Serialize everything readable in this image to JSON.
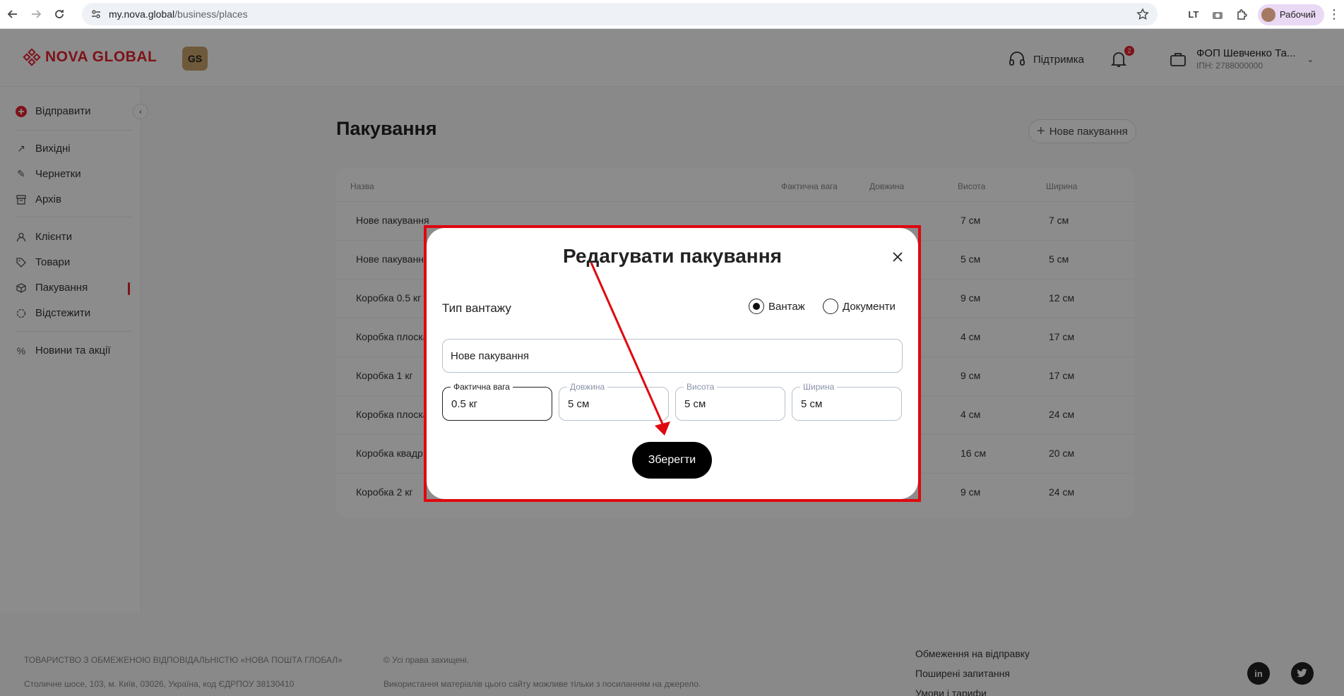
{
  "browser": {
    "url_host": "my.nova.global",
    "url_path": "/business/places",
    "ext_label": "LT",
    "profile_label": "Рабочий"
  },
  "header": {
    "logo_text": "NOVA GLOBAL",
    "badge_text": "GS",
    "support_label": "Підтримка",
    "notifications_count": "2",
    "account_name": "ФОП Шевченко Та...",
    "account_ipn": "ІПН: 2788000000"
  },
  "sidebar": {
    "send": "Відправити",
    "outgoing": "Вихідні",
    "drafts": "Чернетки",
    "archive": "Архів",
    "clients": "Клієнти",
    "goods": "Товари",
    "packaging": "Пакування",
    "track": "Відстежити",
    "news": "Новини та акції"
  },
  "main": {
    "title": "Пакування",
    "new_button": "Нове пакування",
    "columns": [
      "Назва",
      "Фактична вага",
      "Довжина",
      "Висота",
      "Ширина"
    ],
    "rows": [
      {
        "name": "Нове пакування",
        "height": "7 см",
        "width": "7 см"
      },
      {
        "name": "Нове пакування",
        "height": "5 см",
        "width": "5 см"
      },
      {
        "name": "Коробка 0.5 кг",
        "height": "9 см",
        "width": "12 см"
      },
      {
        "name": "Коробка плоска",
        "height": "4 см",
        "width": "17 см"
      },
      {
        "name": "Коробка 1 кг",
        "height": "9 см",
        "width": "17 см"
      },
      {
        "name": "Коробка плоска",
        "height": "4 см",
        "width": "24 см"
      },
      {
        "name": "Коробка квадр",
        "height": "16 см",
        "width": "20 см"
      },
      {
        "name": "Коробка 2 кг",
        "height": "9 см",
        "width": "24 см"
      }
    ]
  },
  "modal": {
    "title": "Редагувати пакування",
    "cargo_type_label": "Тип вантажу",
    "option_cargo": "Вантаж",
    "option_documents": "Документи",
    "name_value": "Нове пакування",
    "weight_label": "Фактична вага",
    "weight_value": "0.5 кг",
    "length_label": "Довжина",
    "length_value": "5 см",
    "height_label": "Висота",
    "height_value": "5 см",
    "width_label": "Ширина",
    "width_value": "5 см",
    "save_label": "Зберегти"
  },
  "footer": {
    "company": "ТОВАРИСТВО З ОБМЕЖЕНОЮ ВІДПОВІДАЛЬНІСТЮ «НОВА ПОШТА ГЛОБАЛ»",
    "address": "Столичне шосе, 103, м. Київ, 03026, Україна, код ЄДРПОУ 38130410",
    "rights": "© Усі права захищені.",
    "usage": "Використання матеріалів цього сайту можливе тільки з посиланням на джерело.",
    "link_restrictions": "Обмеження на відправку",
    "link_faq": "Поширені запитання",
    "link_terms": "Умови і тарифи",
    "linkedin": "in"
  },
  "colors": {
    "brand": "#e3232e",
    "highlight": "#e0070f"
  }
}
